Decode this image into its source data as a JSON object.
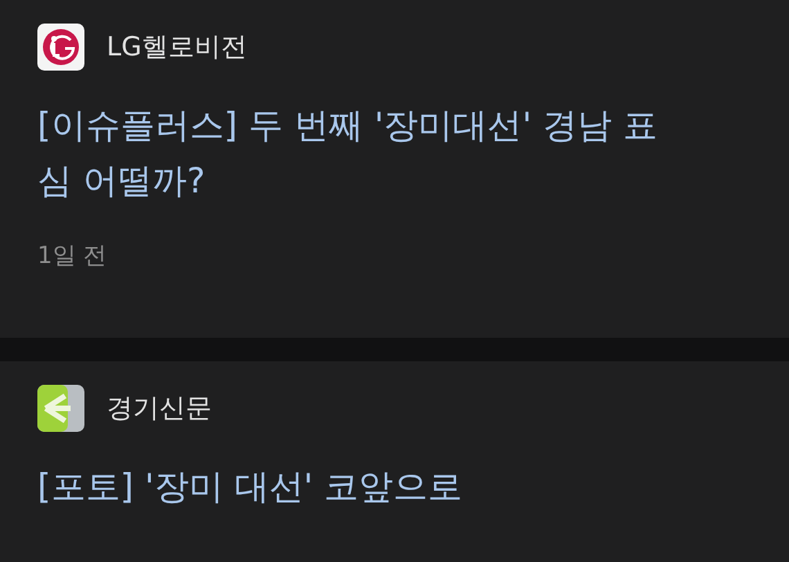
{
  "articles": [
    {
      "source": "LG헬로비전",
      "kind": "lg",
      "title": "[이슈플러스] 두 번째 '장미대선' 경남 표심 어떨까?",
      "time": "1일 전"
    },
    {
      "source": "경기신문",
      "kind": "gg",
      "title": "[포토] '장미 대선' 코앞으로"
    }
  ]
}
